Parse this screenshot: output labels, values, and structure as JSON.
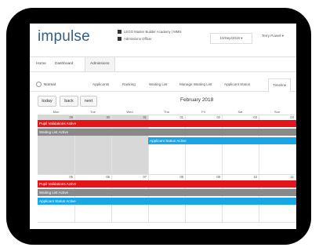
{
  "header": {
    "logo": "impulse",
    "org_name": "LEGO Master Builder Academy | MMN",
    "role": "Admissions Officer",
    "date_select": "10/Sep/2018 ▾",
    "user": "Terry Powell ▾"
  },
  "nav": {
    "items": [
      {
        "label": "Home"
      },
      {
        "label": "Dashboard"
      },
      {
        "label": "Admissions",
        "active": true
      }
    ]
  },
  "tabs": {
    "mode_label": "Normal",
    "items": [
      {
        "label": "Applicants"
      },
      {
        "label": "Ranking"
      },
      {
        "label": "Waiting List"
      },
      {
        "label": "Manage Waiting List"
      },
      {
        "label": "Applicant Status"
      },
      {
        "label": "Timeline",
        "active": true
      }
    ]
  },
  "toolbar": {
    "today": "today",
    "back": "back",
    "next": "next",
    "month": "February 2018"
  },
  "calendar": {
    "dow": [
      "Mon",
      "Tue",
      "Wed",
      "Thu",
      "Fri",
      "Sat",
      "Sun"
    ],
    "week1_days": [
      "29",
      "30",
      "31",
      "01",
      "02",
      "03",
      "04"
    ],
    "week2_days": [
      "05",
      "06",
      "07",
      "08",
      "09",
      "10",
      "11"
    ],
    "week1_bars": [
      "Pupil Validations Active",
      "Waiting List Active",
      "Applicant Status Active"
    ],
    "week2_bars": [
      "Pupil Validations Active",
      "Waiting List Active",
      "Applicant Status Active"
    ],
    "colors": {
      "red": "#e4151a",
      "grey": "#898989",
      "blue": "#19a6e6"
    }
  }
}
